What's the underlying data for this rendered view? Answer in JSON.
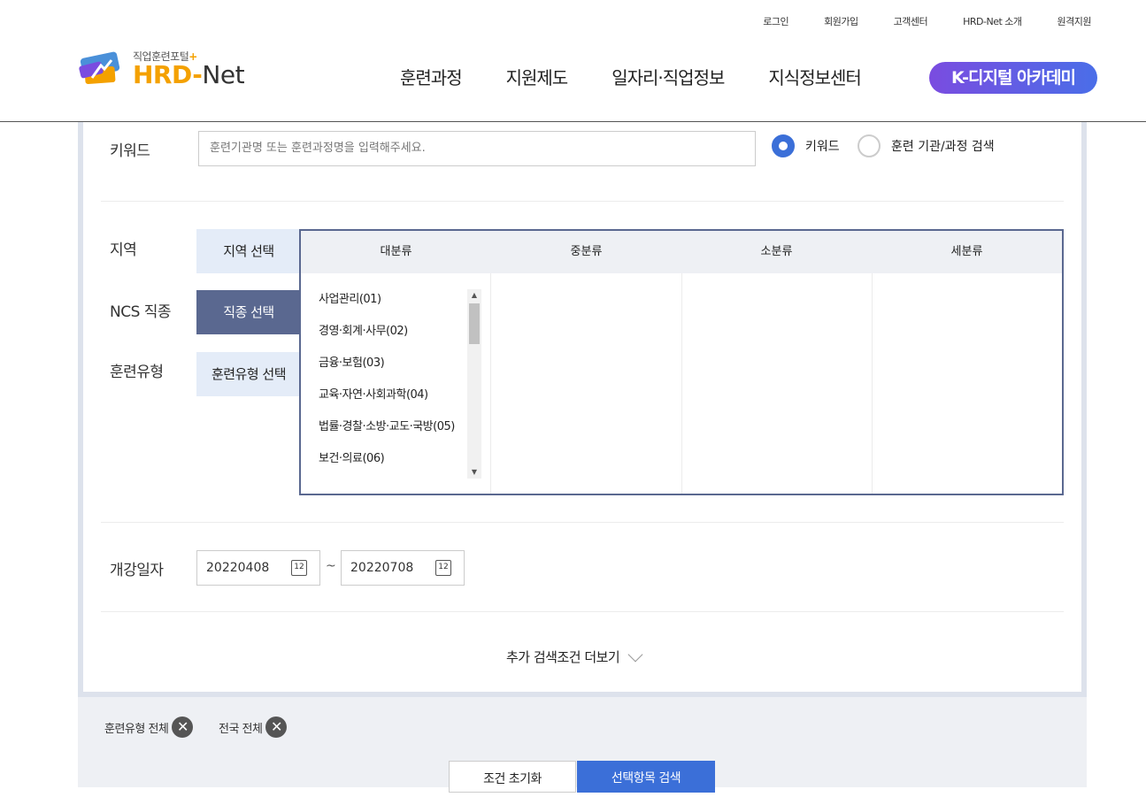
{
  "util_links": [
    "로그인",
    "회원가입",
    "고객센터",
    "HRD-Net 소개",
    "원격지원"
  ],
  "logo": {
    "sub": "직업훈련포털",
    "plus": "+",
    "hrd": "HRD-",
    "net": "Net"
  },
  "gnb": [
    "훈련과정",
    "지원제도",
    "일자리·직업정보",
    "지식정보센터"
  ],
  "gnb_highlight": "K-디지털 아카데미",
  "search": {
    "keyword_label": "키워드",
    "keyword_placeholder": "훈련기관명 또는 훈련과정명을 입력해주세요.",
    "radio_keyword": "키워드",
    "radio_institution": "훈련 기관/과정 검색",
    "region_label": "지역",
    "region_button": "지역 선택",
    "ncs_label": "NCS 직종",
    "ncs_button": "직종 선택",
    "type_label": "훈련유형",
    "type_button": "훈련유형 선택",
    "category_headers": [
      "대분류",
      "중분류",
      "소분류",
      "세분류"
    ],
    "major_categories": [
      "사업관리(01)",
      "경영·회계·사무(02)",
      "금융·보험(03)",
      "교육·자연·사회과학(04)",
      "법률·경찰·소방·교도·국방(05)",
      "보건·의료(06)"
    ],
    "date_label": "개강일자",
    "date_from": "20220408",
    "date_to": "20220708",
    "calendar_day": "12",
    "tilde": "~",
    "more_label": "추가 검색조건 더보기"
  },
  "filters": {
    "chip1": "훈련유형 전체",
    "chip2": "전국 전체",
    "reset_button": "조건 초기화",
    "search_button": "선택항목 검색"
  },
  "colors": {
    "accent": "#3b6fd8",
    "tab_dark": "#5a6890",
    "brand_orange": "#f4a100"
  }
}
